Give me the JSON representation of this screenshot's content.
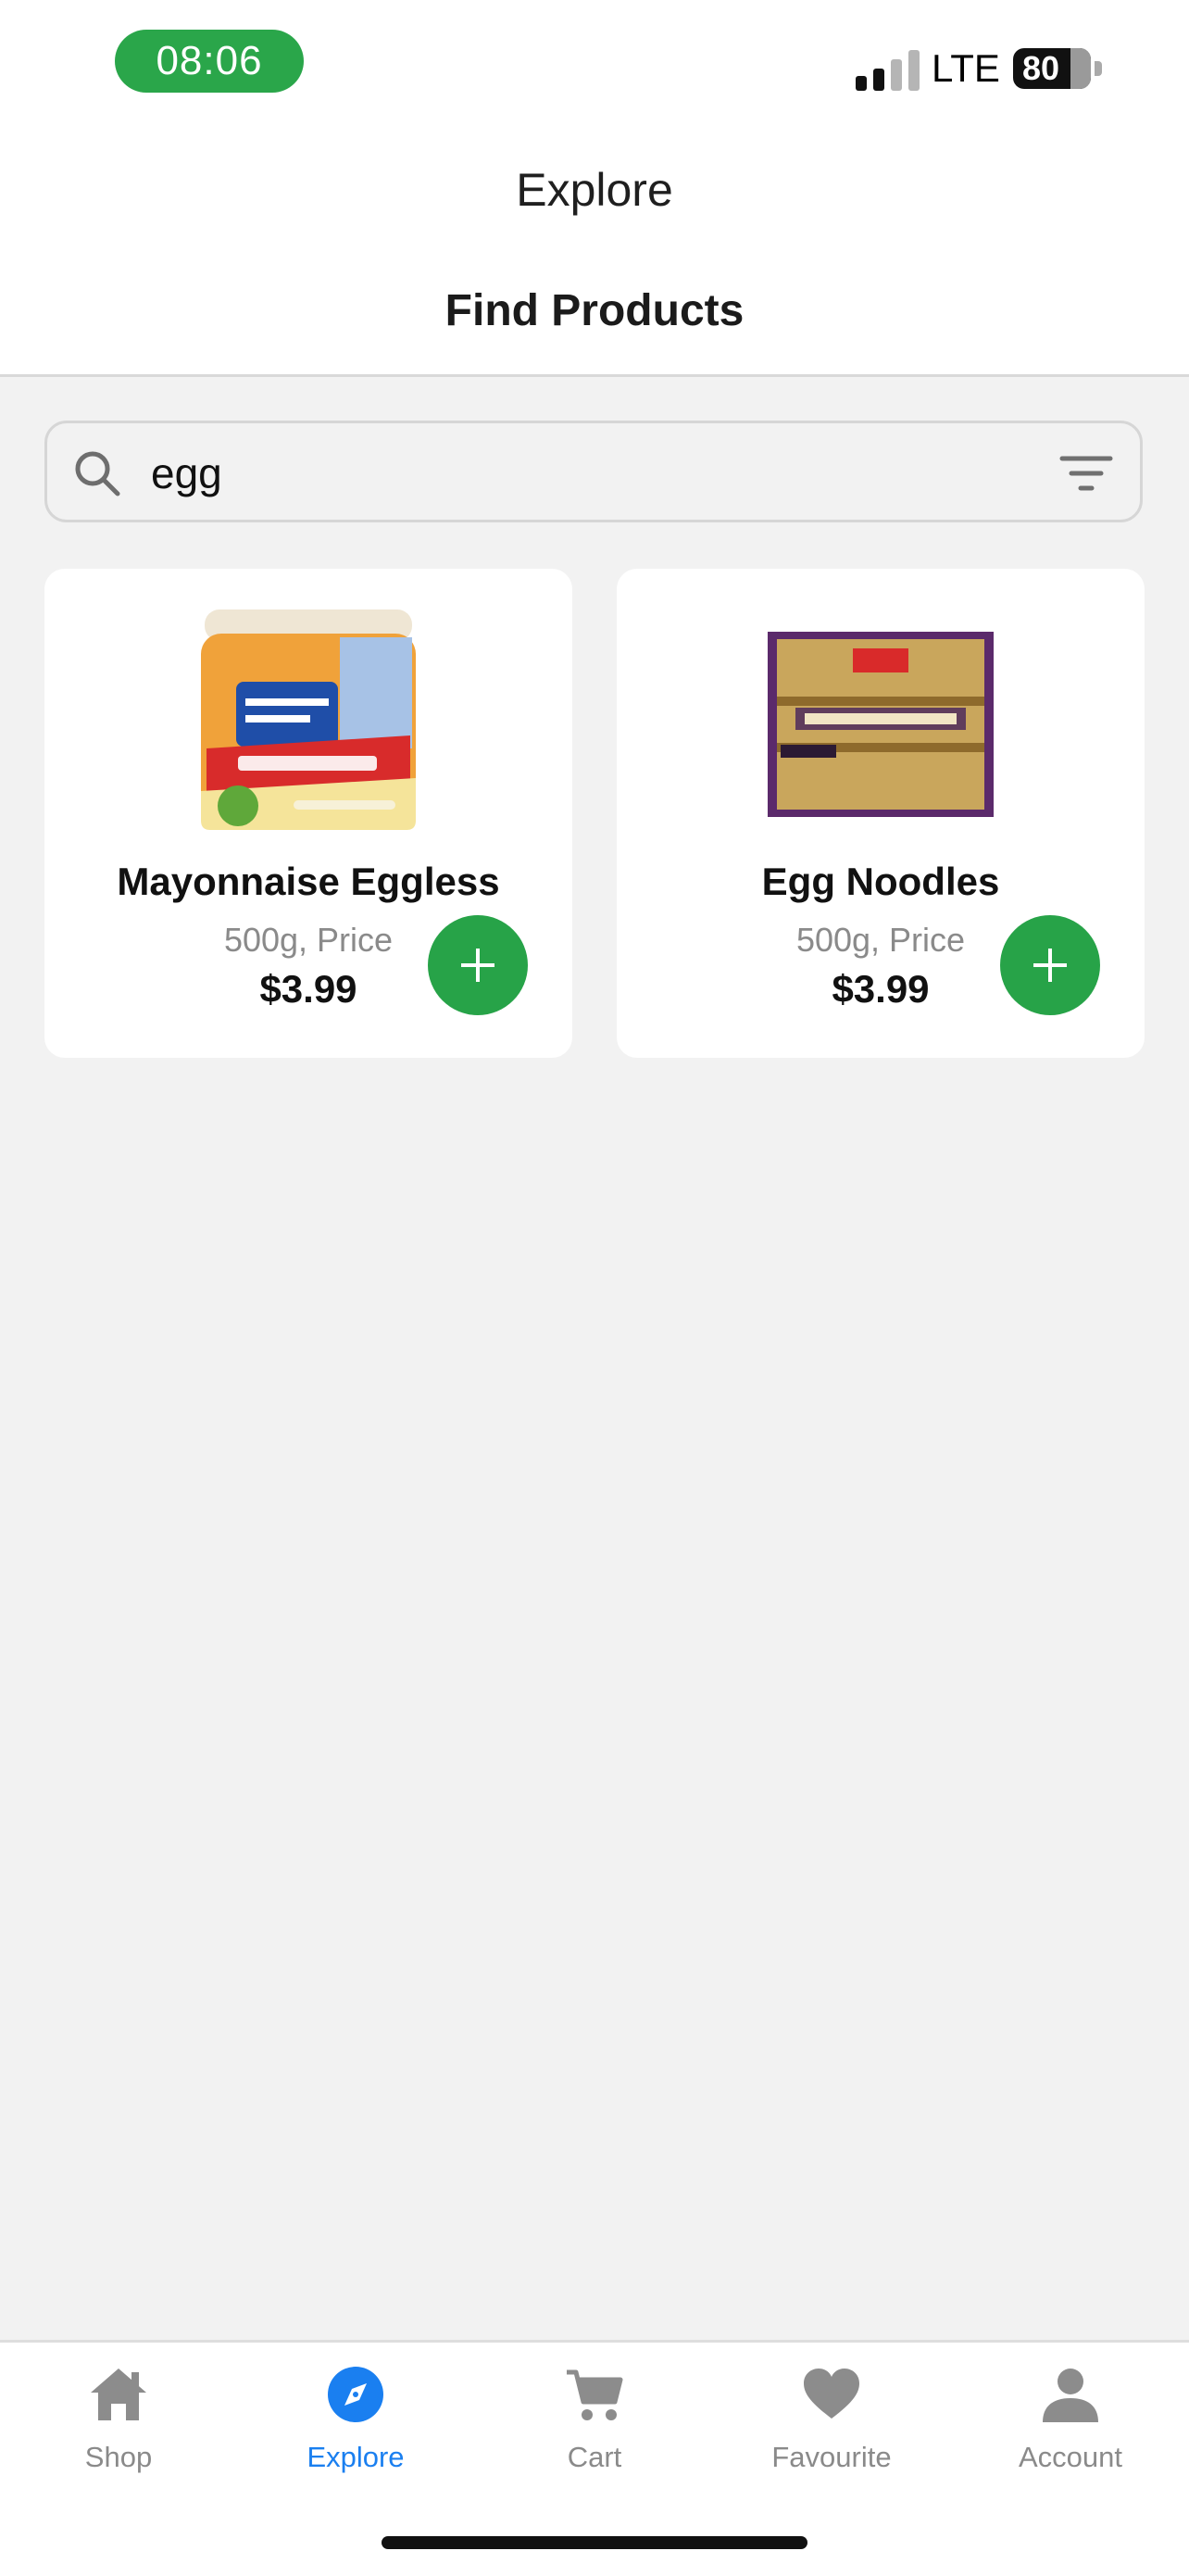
{
  "status_bar": {
    "time": "08:06",
    "network": "LTE",
    "battery": "80"
  },
  "header": {
    "title": "Explore",
    "subtitle": "Find Products"
  },
  "search": {
    "value": "egg",
    "placeholder": ""
  },
  "products": [
    {
      "name": "Mayonnaise Eggless",
      "detail": "500g, Price",
      "price": "$3.99"
    },
    {
      "name": "Egg Noodles",
      "detail": "500g, Price",
      "price": "$3.99"
    }
  ],
  "tabs": [
    {
      "label": "Shop",
      "icon": "home-icon"
    },
    {
      "label": "Explore",
      "icon": "compass-icon"
    },
    {
      "label": "Cart",
      "icon": "cart-icon"
    },
    {
      "label": "Favourite",
      "icon": "heart-icon"
    },
    {
      "label": "Account",
      "icon": "person-icon"
    }
  ],
  "active_tab": "Explore",
  "colors": {
    "accent_green": "#27a348",
    "active_tab_blue": "#1a7ff0",
    "time_pill": "#2aa64a"
  }
}
